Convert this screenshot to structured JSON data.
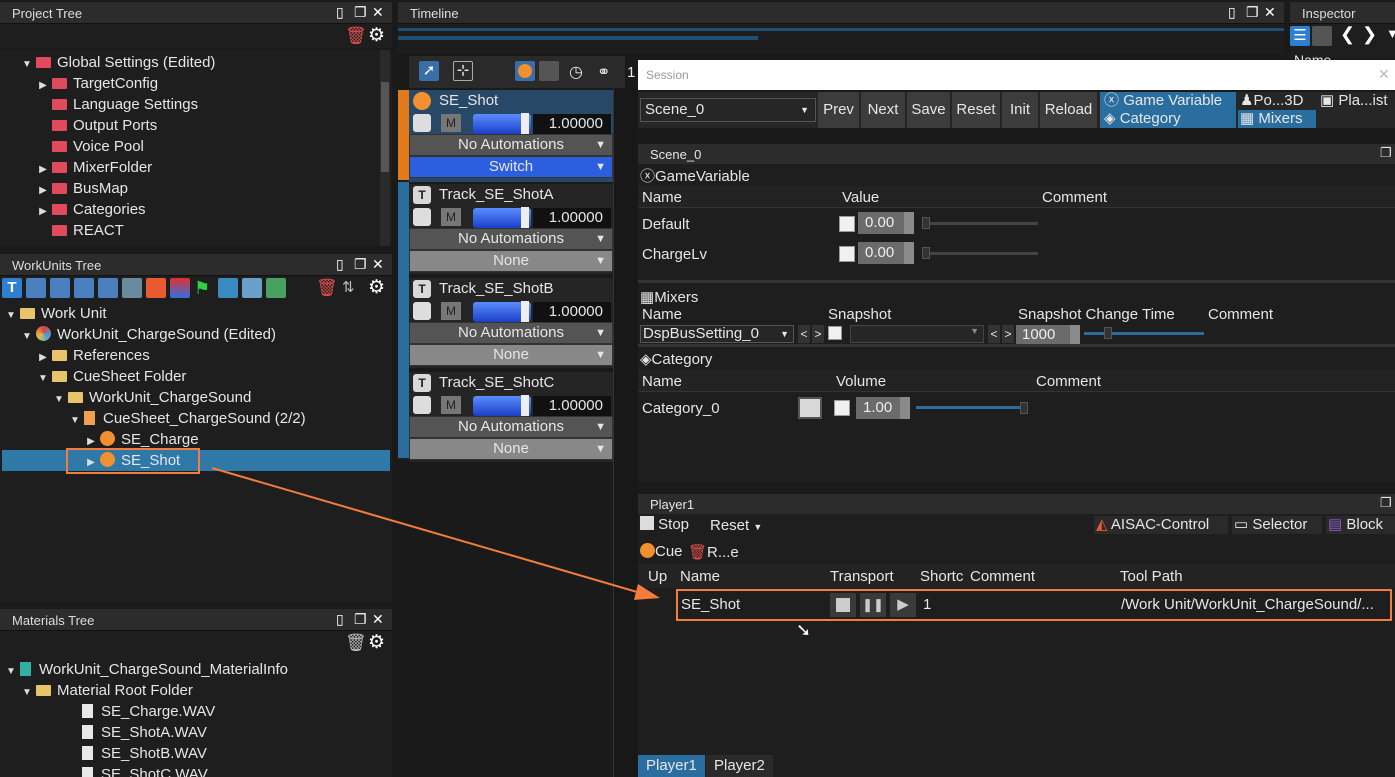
{
  "project_tree": {
    "title": "Project Tree",
    "items": [
      {
        "label": "Global Settings (Edited)",
        "level": 0,
        "expanded": true
      },
      {
        "label": "TargetConfig",
        "level": 1
      },
      {
        "label": "Language Settings",
        "level": 1
      },
      {
        "label": "Output Ports",
        "level": 1
      },
      {
        "label": "Voice Pool",
        "level": 1
      },
      {
        "label": "MixerFolder",
        "level": 1
      },
      {
        "label": "BusMap",
        "level": 1
      },
      {
        "label": "Categories",
        "level": 1
      },
      {
        "label": "REACT",
        "level": 1
      }
    ]
  },
  "workunits_tree": {
    "title": "WorkUnits Tree",
    "items": [
      {
        "label": "Work Unit"
      },
      {
        "label": "WorkUnit_ChargeSound (Edited)"
      },
      {
        "label": "References"
      },
      {
        "label": "CueSheet Folder"
      },
      {
        "label": "WorkUnit_ChargeSound"
      },
      {
        "label": "CueSheet_ChargeSound (2/2)"
      },
      {
        "label": "SE_Charge"
      },
      {
        "label": "SE_Shot"
      }
    ]
  },
  "materials_tree": {
    "title": "Materials Tree",
    "items": [
      {
        "label": "WorkUnit_ChargeSound_MaterialInfo"
      },
      {
        "label": "Material Root Folder"
      },
      {
        "label": "SE_Charge.WAV"
      },
      {
        "label": "SE_ShotA.WAV"
      },
      {
        "label": "SE_ShotB.WAV"
      },
      {
        "label": "SE_ShotC.WAV"
      }
    ]
  },
  "timeline": {
    "title": "Timeline",
    "cursor_number": "1",
    "tracks": [
      {
        "name": "SE_Shot",
        "volume": "1.00000",
        "automation": "No Automations",
        "mode": "Switch",
        "mute": "M"
      },
      {
        "name": "Track_SE_ShotA",
        "volume": "1.00000",
        "automation": "No Automations",
        "mode": "None",
        "mute": "M"
      },
      {
        "name": "Track_SE_ShotB",
        "volume": "1.00000",
        "automation": "No Automations",
        "mode": "None",
        "mute": "M"
      },
      {
        "name": "Track_SE_ShotC",
        "volume": "1.00000",
        "automation": "No Automations",
        "mode": "None",
        "mute": "M"
      }
    ],
    "track_icon": "T"
  },
  "inspector": {
    "title": "Inspector",
    "name_label": "Name"
  },
  "session": {
    "title": "Session",
    "scene": "Scene_0",
    "buttons": [
      "Prev",
      "Next",
      "Save",
      "Reset",
      "Init",
      "Reload"
    ],
    "toggles": {
      "game_variable": "Game Variable",
      "category": "Category",
      "pos3d": "Po...3D",
      "mixers": "Mixers",
      "playlist": "Pla...ist"
    }
  },
  "scene_panel": {
    "title": "Scene_0",
    "game_variable": {
      "section": "GameVariable",
      "headers": [
        "Name",
        "Value",
        "Comment"
      ],
      "rows": [
        {
          "name": "Default",
          "value": "0.00"
        },
        {
          "name": "ChargeLv",
          "value": "0.00"
        }
      ]
    },
    "mixers": {
      "section": "Mixers",
      "headers": [
        "Name",
        "Snapshot",
        "Snapshot Change Time",
        "Comment"
      ],
      "row": {
        "name": "DspBusSetting_0",
        "change_time": "1000",
        "prev": "<",
        "next": ">"
      }
    },
    "category": {
      "section": "Category",
      "headers": [
        "Name",
        "Volume",
        "Comment"
      ],
      "row": {
        "name": "Category_0",
        "volume": "1.00"
      }
    }
  },
  "player": {
    "title": "Player1",
    "stop": "Stop",
    "reset": "Reset",
    "aisac": "AISAC-Control",
    "selector": "Selector",
    "block": "Block",
    "cue_tab": "Cue",
    "remove_tab": "R...e",
    "headers": [
      "Up",
      "Name",
      "Transport",
      "Shortc",
      "Comment",
      "Tool Path"
    ],
    "row": {
      "name": "SE_Shot",
      "shortcut": "1",
      "path": "/Work Unit/WorkUnit_ChargeSound/..."
    },
    "tabs": [
      "Player1",
      "Player2"
    ]
  },
  "colors": {
    "accent": "#2a6ea0",
    "highlight": "#f47c3c",
    "selection": "#2f79a8"
  }
}
